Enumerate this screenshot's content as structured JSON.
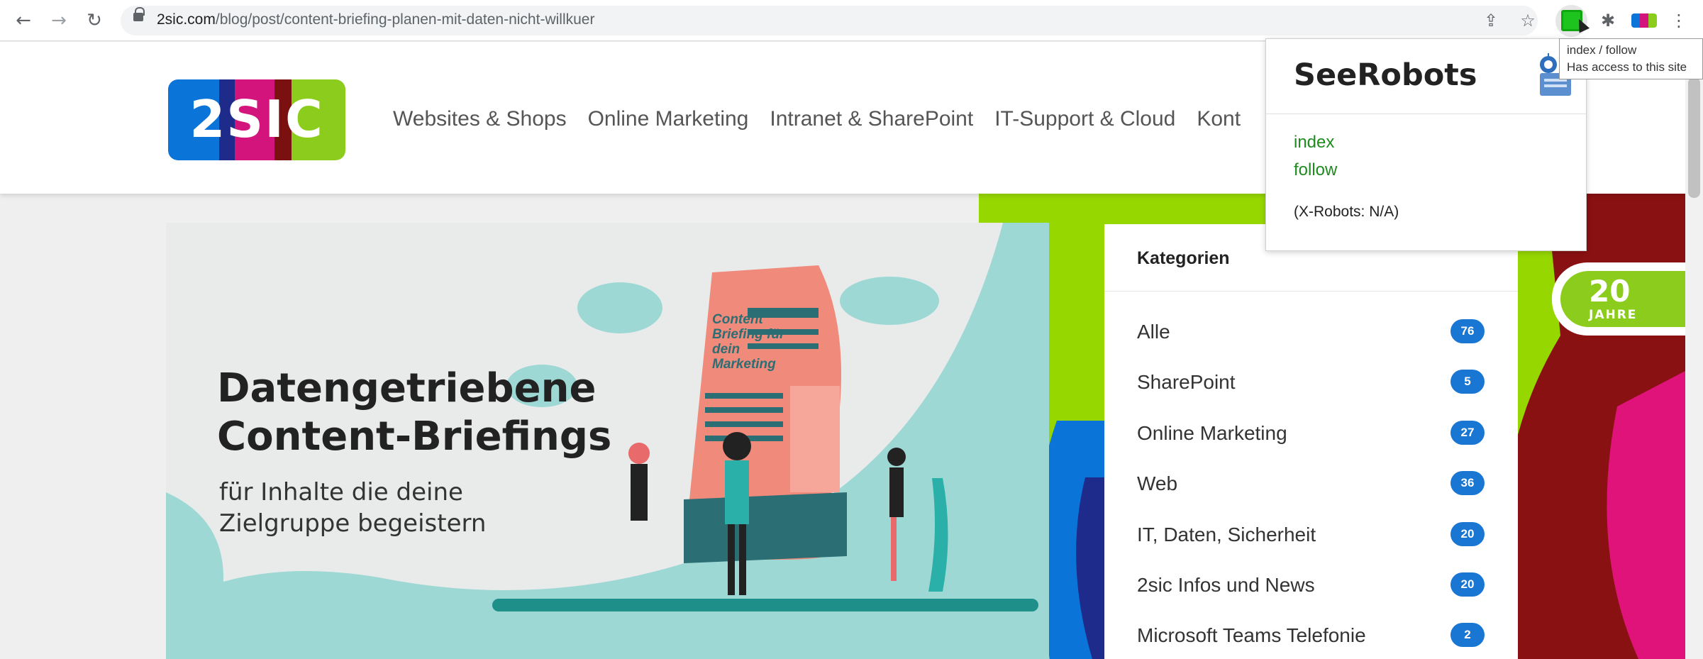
{
  "browser": {
    "url_domain": "2sic.com",
    "url_path": "/blog/post/content-briefing-planen-mit-daten-nicht-willkuer",
    "tooltip_line1": "index / follow",
    "tooltip_line2": "Has access to this site"
  },
  "site": {
    "logo_text": "2SIC",
    "nav": [
      "Websites & Shops",
      "Online Marketing",
      "Intranet & SharePoint",
      "IT-Support & Cloud",
      "Kont"
    ]
  },
  "popup": {
    "title": "SeeRobots",
    "index": "index",
    "follow": "follow",
    "xrobots": "(X-Robots: N/A)"
  },
  "hero": {
    "title_line1": "Datengetriebene",
    "title_line2": "Content-Briefings",
    "subtitle_line1": "für Inhalte die deine",
    "subtitle_line2": "Zielgruppe begeistern",
    "paper_text": "Content Briefing für dein Marketing"
  },
  "sidebar": {
    "heading": "Kategorien",
    "categories": [
      {
        "label": "Alle",
        "count": "76"
      },
      {
        "label": "SharePoint",
        "count": "5"
      },
      {
        "label": "Online Marketing",
        "count": "27"
      },
      {
        "label": "Web",
        "count": "36"
      },
      {
        "label": "IT, Daten, Sicherheit",
        "count": "20"
      },
      {
        "label": "2sic Infos und News",
        "count": "20"
      },
      {
        "label": "Microsoft Teams Telefonie",
        "count": "2"
      }
    ]
  },
  "badge": {
    "number": "20",
    "label": "JAHRE"
  },
  "colors": {
    "brand_green": "#8ccc1c",
    "brand_blue": "#0a74d8",
    "brand_pink": "#d3147c",
    "badge_blue": "#1976d2",
    "robots_green": "#1f8b1f"
  }
}
